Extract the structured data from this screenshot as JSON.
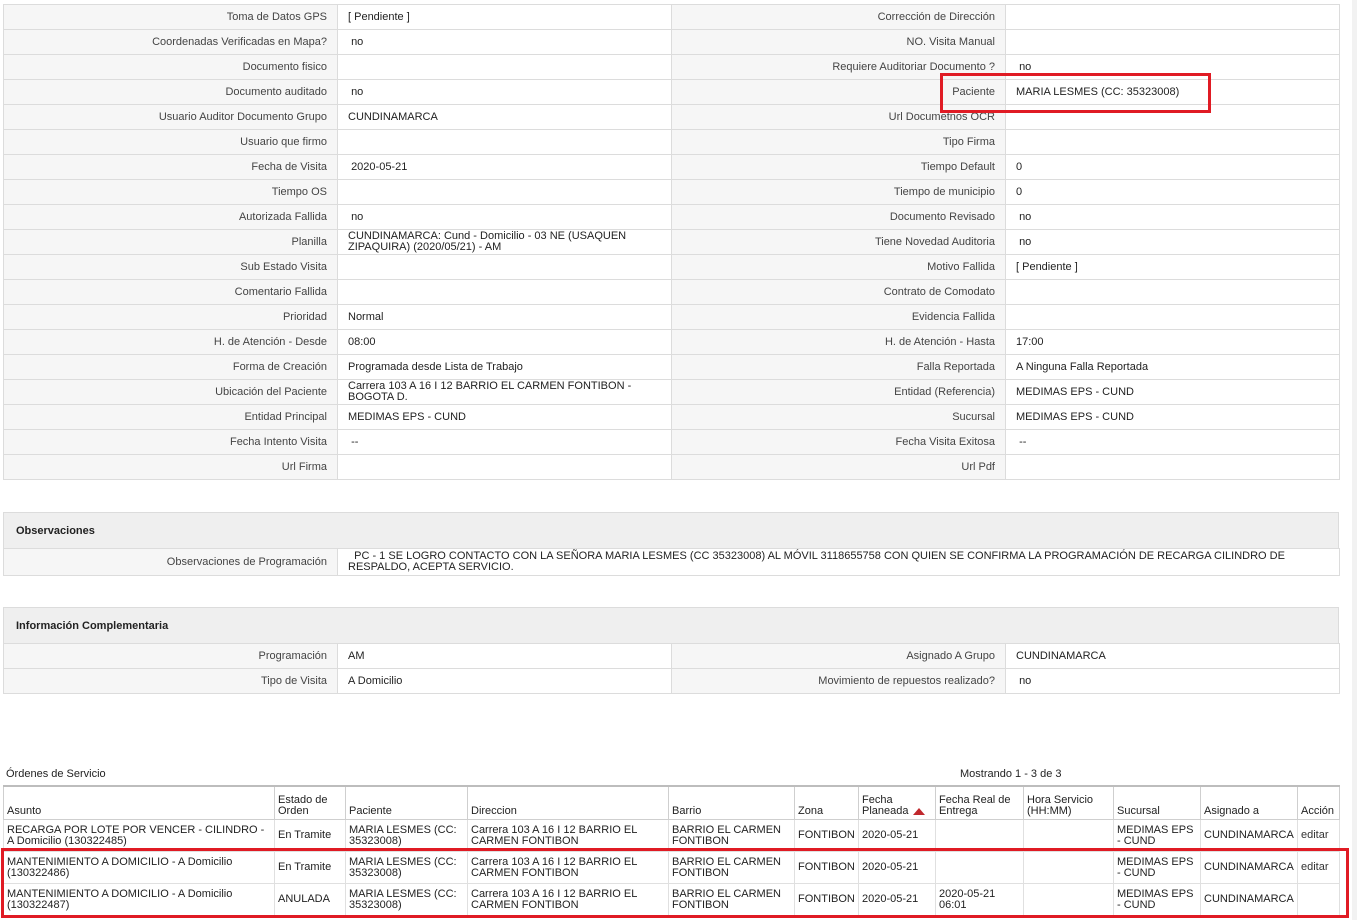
{
  "details": [
    [
      "Toma de Datos GPS",
      "[ Pendiente ]",
      "Corrección de Dirección",
      ""
    ],
    [
      "Coordenadas Verificadas en Mapa?",
      " no",
      "NO. Visita Manual",
      ""
    ],
    [
      "Documento fisico",
      "",
      "Requiere Auditoriar Documento ?",
      " no"
    ],
    [
      "Documento auditado",
      " no",
      "Paciente",
      "MARIA LESMES (CC: 35323008)"
    ],
    [
      "Usuario Auditor Documento Grupo",
      "CUNDINAMARCA",
      "Url Documetnos OCR",
      ""
    ],
    [
      "Usuario que firmo",
      "",
      "Tipo Firma",
      ""
    ],
    [
      "Fecha de Visita",
      " 2020-05-21",
      "Tiempo Default",
      "0"
    ],
    [
      "Tiempo OS",
      "",
      "Tiempo de municipio",
      "0"
    ],
    [
      "Autorizada Fallida",
      " no",
      "Documento Revisado",
      " no"
    ],
    [
      "Planilla",
      "CUNDINAMARCA: Cund - Domicilio - 03 NE (USAQUEN ZIPAQUIRA) (2020/05/21) - AM",
      "Tiene Novedad Auditoria",
      " no"
    ],
    [
      "Sub Estado Visita",
      "",
      "Motivo Fallida",
      "[ Pendiente ]"
    ],
    [
      "Comentario Fallida",
      "",
      "Contrato de Comodato",
      ""
    ],
    [
      "Prioridad",
      "Normal",
      "Evidencia Fallida",
      ""
    ],
    [
      "H. de Atención - Desde",
      "08:00",
      "H. de Atención - Hasta",
      "17:00"
    ],
    [
      "Forma de Creación",
      "Programada desde Lista de Trabajo",
      "Falla Reportada",
      "A Ninguna Falla Reportada"
    ],
    [
      "Ubicación del Paciente",
      "Carrera 103 A 16 I 12 BARRIO EL CARMEN FONTIBON - BOGOTA D.",
      "Entidad (Referencia)",
      "MEDIMAS EPS - CUND"
    ],
    [
      "Entidad Principal",
      "MEDIMAS EPS - CUND",
      "Sucursal",
      "MEDIMAS EPS - CUND"
    ],
    [
      "Fecha Intento Visita",
      " --",
      "Fecha Visita Exitosa",
      " --"
    ],
    [
      "Url Firma",
      "",
      "Url Pdf",
      ""
    ]
  ],
  "observaciones": {
    "title": "Observaciones",
    "label": "Observaciones de Programación",
    "value": "  PC - 1 SE LOGRO CONTACTO CON LA SEÑORA MARIA LESMES (CC 35323008) AL MÓVIL 3118655758 CON QUIEN SE CONFIRMA LA PROGRAMACIÓN DE RECARGA CILINDRO DE RESPALDO, ACEPTA SERVICIO."
  },
  "info": {
    "title": "Información Complementaria",
    "rows": [
      [
        "Programación",
        "AM",
        "Asignado A Grupo",
        "CUNDINAMARCA"
      ],
      [
        "Tipo de Visita",
        "A Domicilio",
        "Movimiento de repuestos realizado?",
        " no"
      ]
    ]
  },
  "orders": {
    "title": "Órdenes de Servicio",
    "count": "Mostrando 1 - 3 de 3",
    "headers": [
      "Asunto",
      "Estado de Orden",
      "Paciente",
      "Direccion",
      "Barrio",
      "Zona",
      "Fecha Planeada",
      "Fecha Real de Entrega",
      "Hora Servicio (HH:MM)",
      "Sucursal",
      "Asignado a",
      "Acción"
    ],
    "rows": [
      [
        "RECARGA POR LOTE POR VENCER - CILINDRO - A Domicilio (130322485)",
        "En Tramite",
        "MARIA LESMES (CC: 35323008)",
        "Carrera 103 A 16 I 12 BARRIO EL CARMEN FONTIBON",
        "BARRIO EL CARMEN FONTIBON",
        "FONTIBON",
        "2020-05-21",
        "",
        "",
        "MEDIMAS EPS - CUND",
        "CUNDINAMARCA",
        "editar"
      ],
      [
        "MANTENIMIENTO A DOMICILIO - A Domicilio (130322486)",
        "En Tramite",
        "MARIA LESMES (CC: 35323008)",
        "Carrera 103 A 16 I 12 BARRIO EL CARMEN FONTIBON",
        "BARRIO EL CARMEN FONTIBON",
        "FONTIBON",
        "2020-05-21",
        "",
        "",
        "MEDIMAS EPS - CUND",
        "CUNDINAMARCA",
        "editar"
      ],
      [
        "MANTENIMIENTO A DOMICILIO - A Domicilio (130322487)",
        "ANULADA",
        "MARIA LESMES (CC: 35323008)",
        "Carrera 103 A 16 I 12 BARRIO EL CARMEN FONTIBON",
        "BARRIO EL CARMEN FONTIBON",
        "FONTIBON",
        "2020-05-21",
        "2020-05-21 06:01",
        "",
        "MEDIMAS EPS - CUND",
        "CUNDINAMARCA",
        ""
      ]
    ]
  },
  "colors": {
    "highlight": "#e01b24",
    "label_bg": "#f6f6f6",
    "section_bg": "#efefef",
    "sort_arrow": "#c0282d"
  }
}
